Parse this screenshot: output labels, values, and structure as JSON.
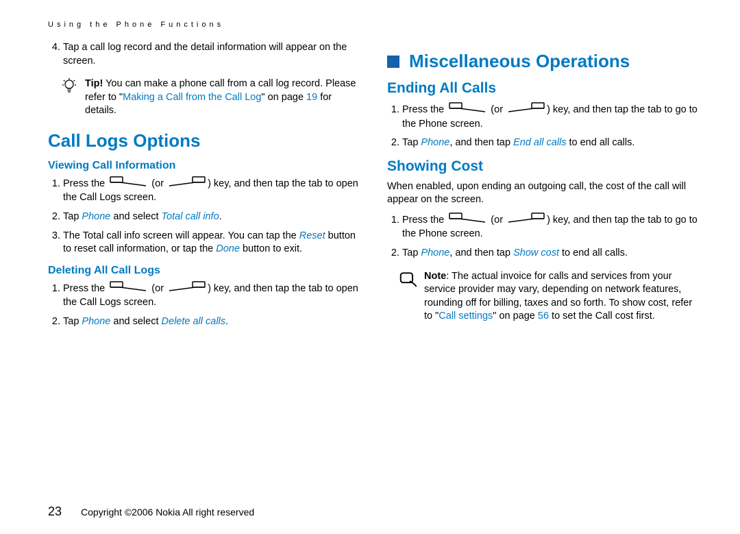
{
  "header": {
    "running": "Using the Phone Functions"
  },
  "left": {
    "list1": {
      "item4_a": "Tap a call log record and the detail information will appear on the screen."
    },
    "tip": {
      "label": "Tip!",
      "text_a": "You can make a phone call from a call log record. Please refer to \"",
      "link": "Making a Call from the Call Log",
      "text_b": "\" on page ",
      "page": "19",
      "text_c": " for details."
    },
    "h1": "Call Logs Options",
    "viewing": {
      "title": "Viewing Call Information",
      "step1_a": "Press the ",
      "step1_or": " (or ",
      "step1_b": ") key, and then tap the tab to open the Call Logs screen.",
      "step2_a": "Tap ",
      "step2_phone": "Phone",
      "step2_b": " and select ",
      "step2_total": "Total call info",
      "step2_c": ".",
      "step3_a": "The Total call info screen will appear. You can tap the ",
      "step3_reset": "Reset",
      "step3_b": " button to reset call information, or tap the ",
      "step3_done": "Done",
      "step3_c": " button to exit."
    },
    "deleting": {
      "title": "Deleting All Call Logs",
      "step1_a": "Press the ",
      "step1_or": " (or ",
      "step1_b": ") key, and then tap the tab to open the Call Logs screen.",
      "step2_a": "Tap ",
      "step2_phone": "Phone",
      "step2_b": " and select ",
      "step2_del": "Delete all calls",
      "step2_c": "."
    }
  },
  "right": {
    "h1": "Miscellaneous Operations",
    "ending": {
      "title": "Ending All Calls",
      "step1_a": "Press the ",
      "step1_or": " (or ",
      "step1_b": ") key, and then tap the tab to go to the Phone screen.",
      "step2_a": "Tap ",
      "step2_phone": "Phone",
      "step2_b": ", and then tap ",
      "step2_end": "End all calls",
      "step2_c": " to end all calls."
    },
    "cost": {
      "title": "Showing Cost",
      "intro": "When enabled, upon ending an outgoing call, the cost of the call will appear on the screen.",
      "step1_a": "Press the ",
      "step1_or": " (or ",
      "step1_b": ") key, and then tap the tab to go to the Phone screen.",
      "step2_a": "Tap ",
      "step2_phone": "Phone",
      "step2_b": ", and then tap ",
      "step2_show": "Show cost",
      "step2_c": " to end all calls."
    },
    "note": {
      "label": "Note",
      "text_a": ": The actual invoice for calls and services from your service provider may vary, depending on network features, rounding off for billing, taxes and so forth. To show cost, refer to \"",
      "link": "Call settings",
      "text_b": "\" on page ",
      "page": "56",
      "text_c": " to set the Call cost first."
    }
  },
  "footer": {
    "page": "23",
    "copyright": "Copyright ©2006 Nokia All right reserved"
  }
}
